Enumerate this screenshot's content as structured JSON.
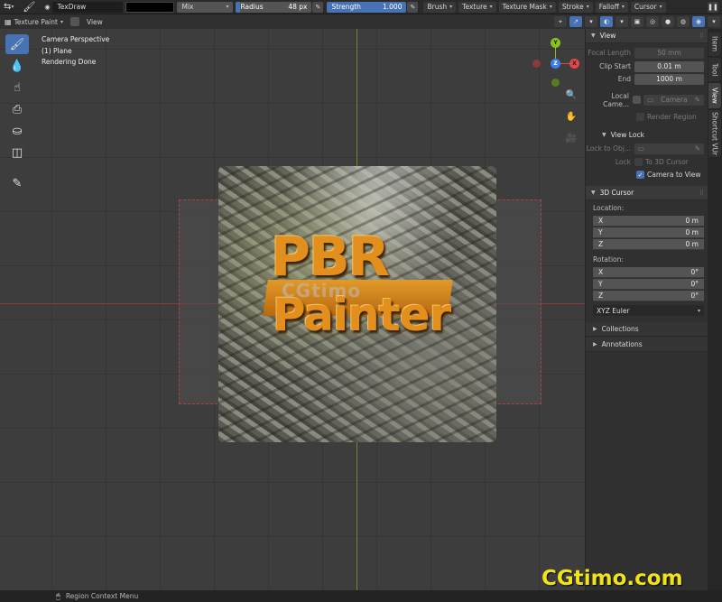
{
  "header": {
    "brush_name": "TexDraw",
    "blend_mode": "Mix",
    "radius_label": "Radius",
    "radius_value": "48 px",
    "strength_label": "Strength",
    "strength_value": "1.000",
    "menus": [
      "Brush",
      "Texture",
      "Texture Mask",
      "Stroke",
      "Falloff",
      "Cursor"
    ]
  },
  "header2": {
    "mode": "Texture Paint",
    "view_menu": "View"
  },
  "viewport": {
    "info_lines": [
      "Camera Perspective",
      "(1) Plane",
      "Rendering Done"
    ],
    "image_text_line1": "PBR",
    "image_text_line2": "Painter",
    "image_watermark": "CGtimo"
  },
  "sidebar": {
    "view_panel": {
      "title": "View",
      "focal_length_label": "Focal Length",
      "focal_length_value": "50 mm",
      "clip_start_label": "Clip Start",
      "clip_start_value": "0.01 m",
      "clip_end_label": "End",
      "clip_end_value": "1000 m",
      "local_camera_label": "Local Came...",
      "local_camera_value": "Camera",
      "render_region_label": "Render Region",
      "view_lock_title": "View Lock",
      "lock_to_object_label": "Lock to Obj...",
      "lock_label": "Lock",
      "to_3d_cursor_label": "To 3D Cursor",
      "camera_to_view_label": "Camera to View"
    },
    "cursor_panel": {
      "title": "3D Cursor",
      "location_label": "Location:",
      "location": [
        {
          "axis": "X",
          "value": "0 m"
        },
        {
          "axis": "Y",
          "value": "0 m"
        },
        {
          "axis": "Z",
          "value": "0 m"
        }
      ],
      "rotation_label": "Rotation:",
      "rotation": [
        {
          "axis": "X",
          "value": "0°"
        },
        {
          "axis": "Y",
          "value": "0°"
        },
        {
          "axis": "Z",
          "value": "0°"
        }
      ],
      "rotation_mode": "XYZ Euler"
    },
    "collections_label": "Collections",
    "annotations_label": "Annotations"
  },
  "tabs": [
    "Item",
    "Tool",
    "View",
    "Shortcut VUr"
  ],
  "statusbar": {
    "hint": "Region Context Menu"
  },
  "watermark": "CGtimo.com",
  "colors": {
    "accent": "#4772b3",
    "x_axis": "#e8454a",
    "y_axis": "#8ac11e",
    "z_axis": "#3b80e8",
    "watermark": "#f0e31a"
  }
}
